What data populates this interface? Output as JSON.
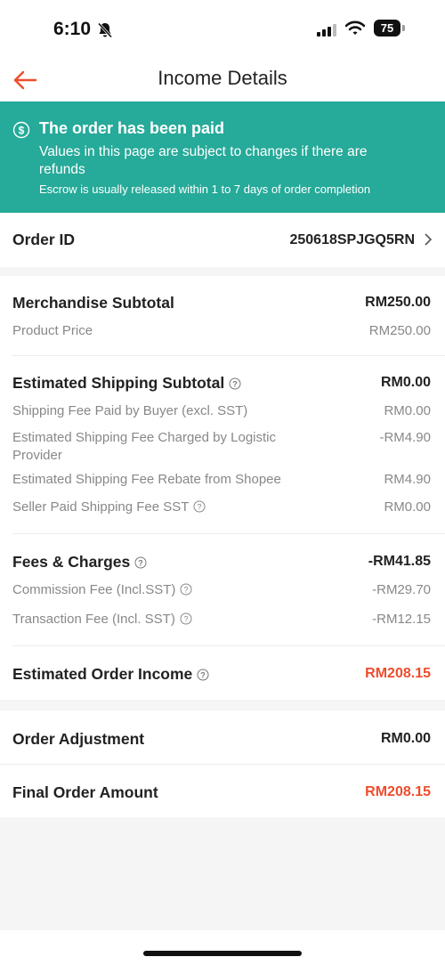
{
  "status_bar": {
    "time": "6:10",
    "battery": "75",
    "icons": [
      "bell-slash-icon",
      "signal-icon",
      "wifi-icon",
      "battery-icon"
    ]
  },
  "nav": {
    "title": "Income Details",
    "back_icon": "arrow-left-icon",
    "accent_color": "#ee4d2d"
  },
  "banner": {
    "title": "The order has been paid",
    "subtitle": "Values in this page are subject to changes if there are refunds",
    "note": "Escrow is usually released within 1 to 7 days of order completion",
    "icon": "dollar-circle-icon",
    "background_color": "#26aa99"
  },
  "order": {
    "label": "Order ID",
    "value": "250618SPJGQ5RN"
  },
  "merchandise": {
    "label": "Merchandise Subtotal",
    "value": "RM250.00",
    "items": [
      {
        "label": "Product Price",
        "value": "RM250.00"
      }
    ]
  },
  "shipping": {
    "label": "Estimated Shipping Subtotal",
    "value": "RM0.00",
    "items": [
      {
        "label": "Shipping Fee Paid by Buyer (excl. SST)",
        "value": "RM0.00"
      },
      {
        "label": "Estimated Shipping Fee Charged by Logistic Provider",
        "value": "-RM4.90"
      },
      {
        "label": "Estimated Shipping Fee Rebate from Shopee",
        "value": "RM4.90"
      },
      {
        "label": "Seller Paid Shipping Fee SST",
        "value": "RM0.00"
      }
    ]
  },
  "fees": {
    "label": "Fees & Charges",
    "value": "-RM41.85",
    "items": [
      {
        "label": "Commission Fee (Incl.SST)",
        "value": "-RM29.70"
      },
      {
        "label": "Transaction Fee (Incl. SST)",
        "value": "-RM12.15"
      }
    ]
  },
  "income": {
    "label": "Estimated Order Income",
    "value": "RM208.15"
  },
  "adjustment": {
    "label": "Order Adjustment",
    "value": "RM0.00"
  },
  "final": {
    "label": "Final Order Amount",
    "value": "RM208.15"
  }
}
